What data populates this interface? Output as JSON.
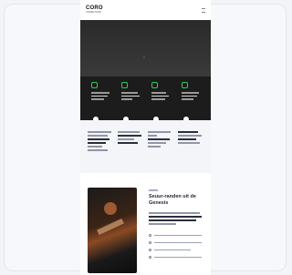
{
  "header": {
    "logo_main": "CORO",
    "logo_sub": "UNDERTONE"
  },
  "about": {
    "title": "Seuur-randen uit de Genesis"
  },
  "colors": {
    "accent": "#36c85a",
    "dark": "#1c1c1c",
    "hero": "#2f2f2f"
  },
  "icons": {
    "menu": "hamburger-icon",
    "feature": "feature-icon"
  }
}
